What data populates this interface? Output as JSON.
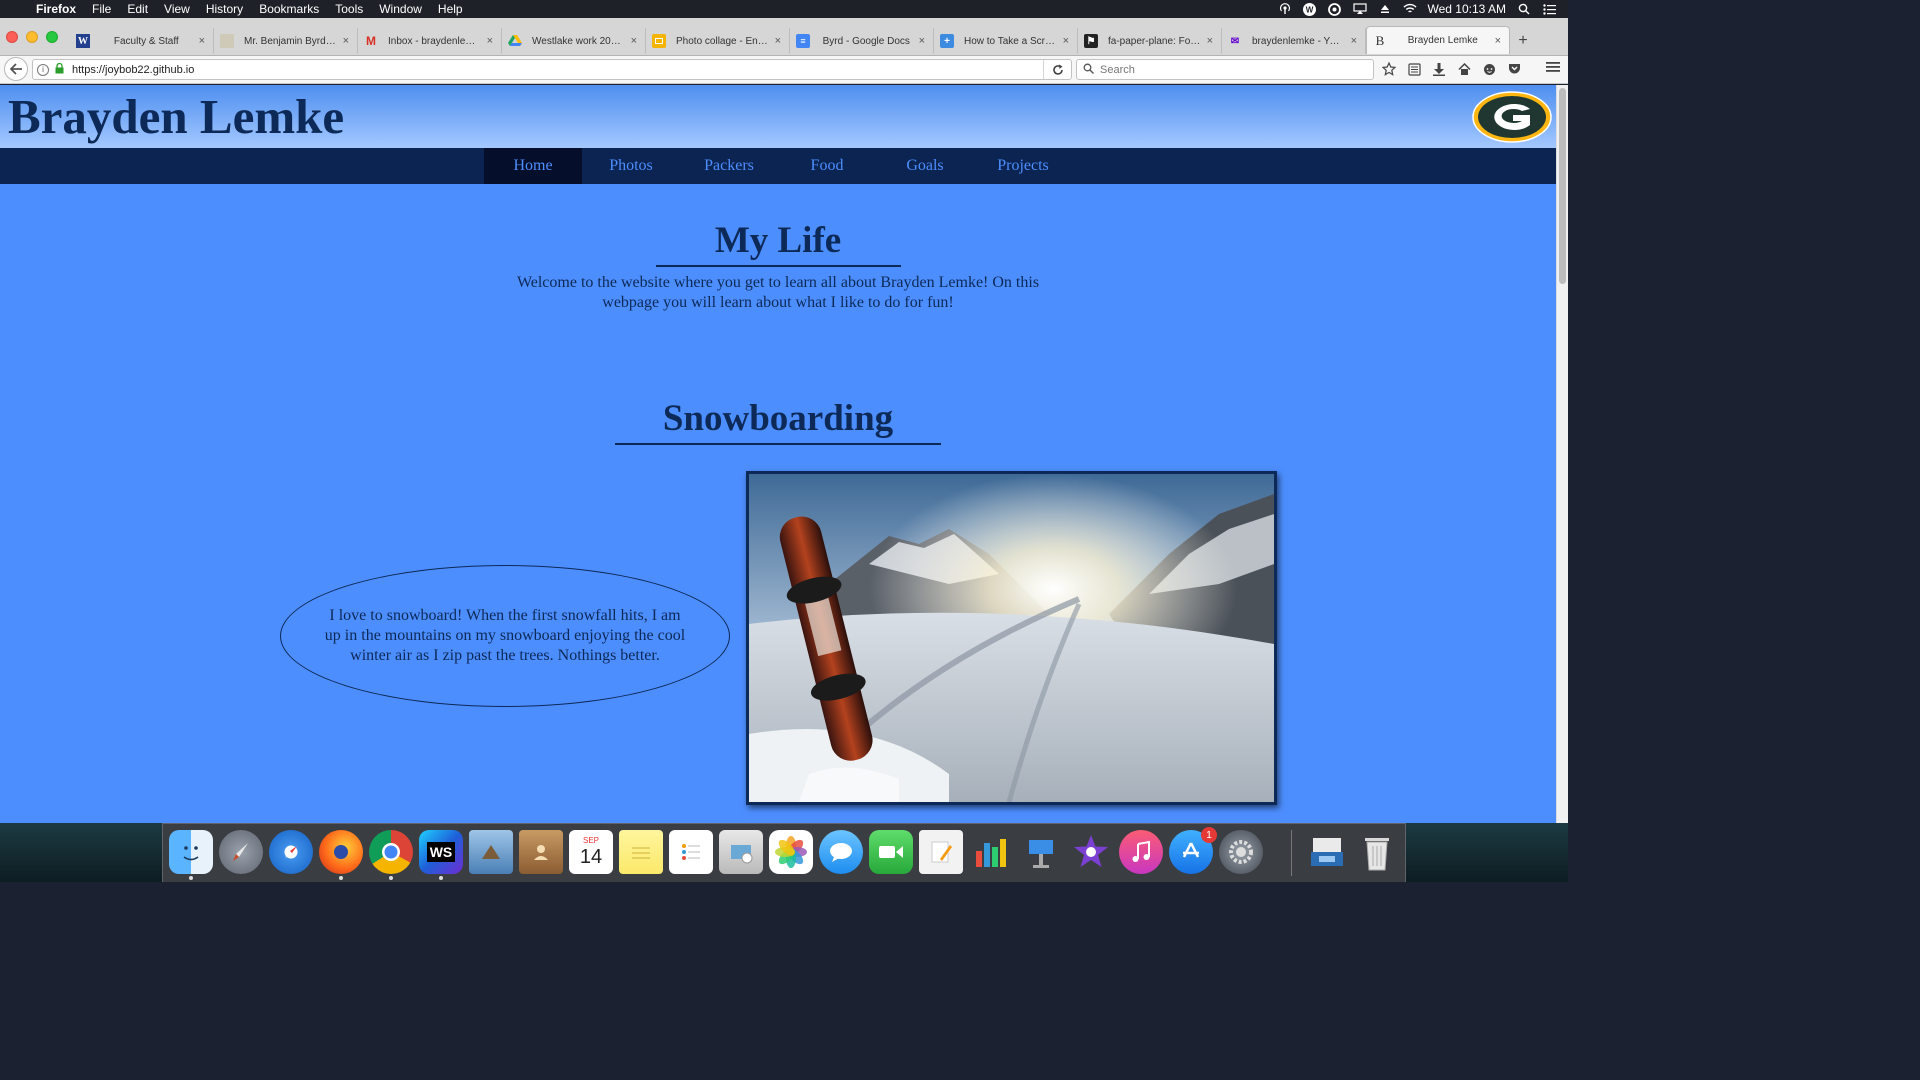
{
  "menubar": {
    "app": "Firefox",
    "items": [
      "File",
      "Edit",
      "View",
      "History",
      "Bookmarks",
      "Tools",
      "Window",
      "Help"
    ],
    "clock": "Wed 10:13 AM"
  },
  "tabs": [
    {
      "title": "Faculty & Staff",
      "favicon": "W"
    },
    {
      "title": "Mr. Benjamin Byrd - ...",
      "favicon": "🖼"
    },
    {
      "title": "Inbox - braydenlemk...",
      "favicon": "M"
    },
    {
      "title": "Westlake work 2016-...",
      "favicon": "▲"
    },
    {
      "title": "Photo collage - Engli...",
      "favicon": "▭"
    },
    {
      "title": "Byrd - Google Docs",
      "favicon": "≡"
    },
    {
      "title": "How to Take a Scree...",
      "favicon": "+"
    },
    {
      "title": "fa-paper-plane: Font...",
      "favicon": "⚑"
    },
    {
      "title": "braydenlemke - Yah...",
      "favicon": "✉"
    },
    {
      "title": "Brayden Lemke",
      "favicon": "B"
    }
  ],
  "navbar": {
    "url": "https://joybob22.github.io",
    "search_placeholder": "Search"
  },
  "site": {
    "title": "Brayden Lemke",
    "nav": [
      "Home",
      "Photos",
      "Packers",
      "Food",
      "Goals",
      "Projects"
    ],
    "active_nav": "Home",
    "logo_letter": "G",
    "section1": {
      "heading": "My Life",
      "text": "Welcome to the website where you get to learn all about Brayden Lemke! On this webpage you will learn about what I like to do for fun!"
    },
    "section2": {
      "heading": "Snowboarding",
      "text": "I love to snowboard! When the first snowfall hits, I am up in the mountains on my snowboard enjoying the cool winter air as I zip past the trees. Nothings better."
    }
  },
  "dock": {
    "calendar_month": "SEP",
    "calendar_day": "14",
    "appstore_badge": "1",
    "webstorm_label": "WS"
  },
  "colors": {
    "page_bg": "#4d8efe",
    "nav_bg": "#0b2452",
    "nav_active_bg": "#050f2c",
    "title_color": "#0c2957",
    "packers_green": "#203731",
    "packers_gold": "#ffb612"
  }
}
